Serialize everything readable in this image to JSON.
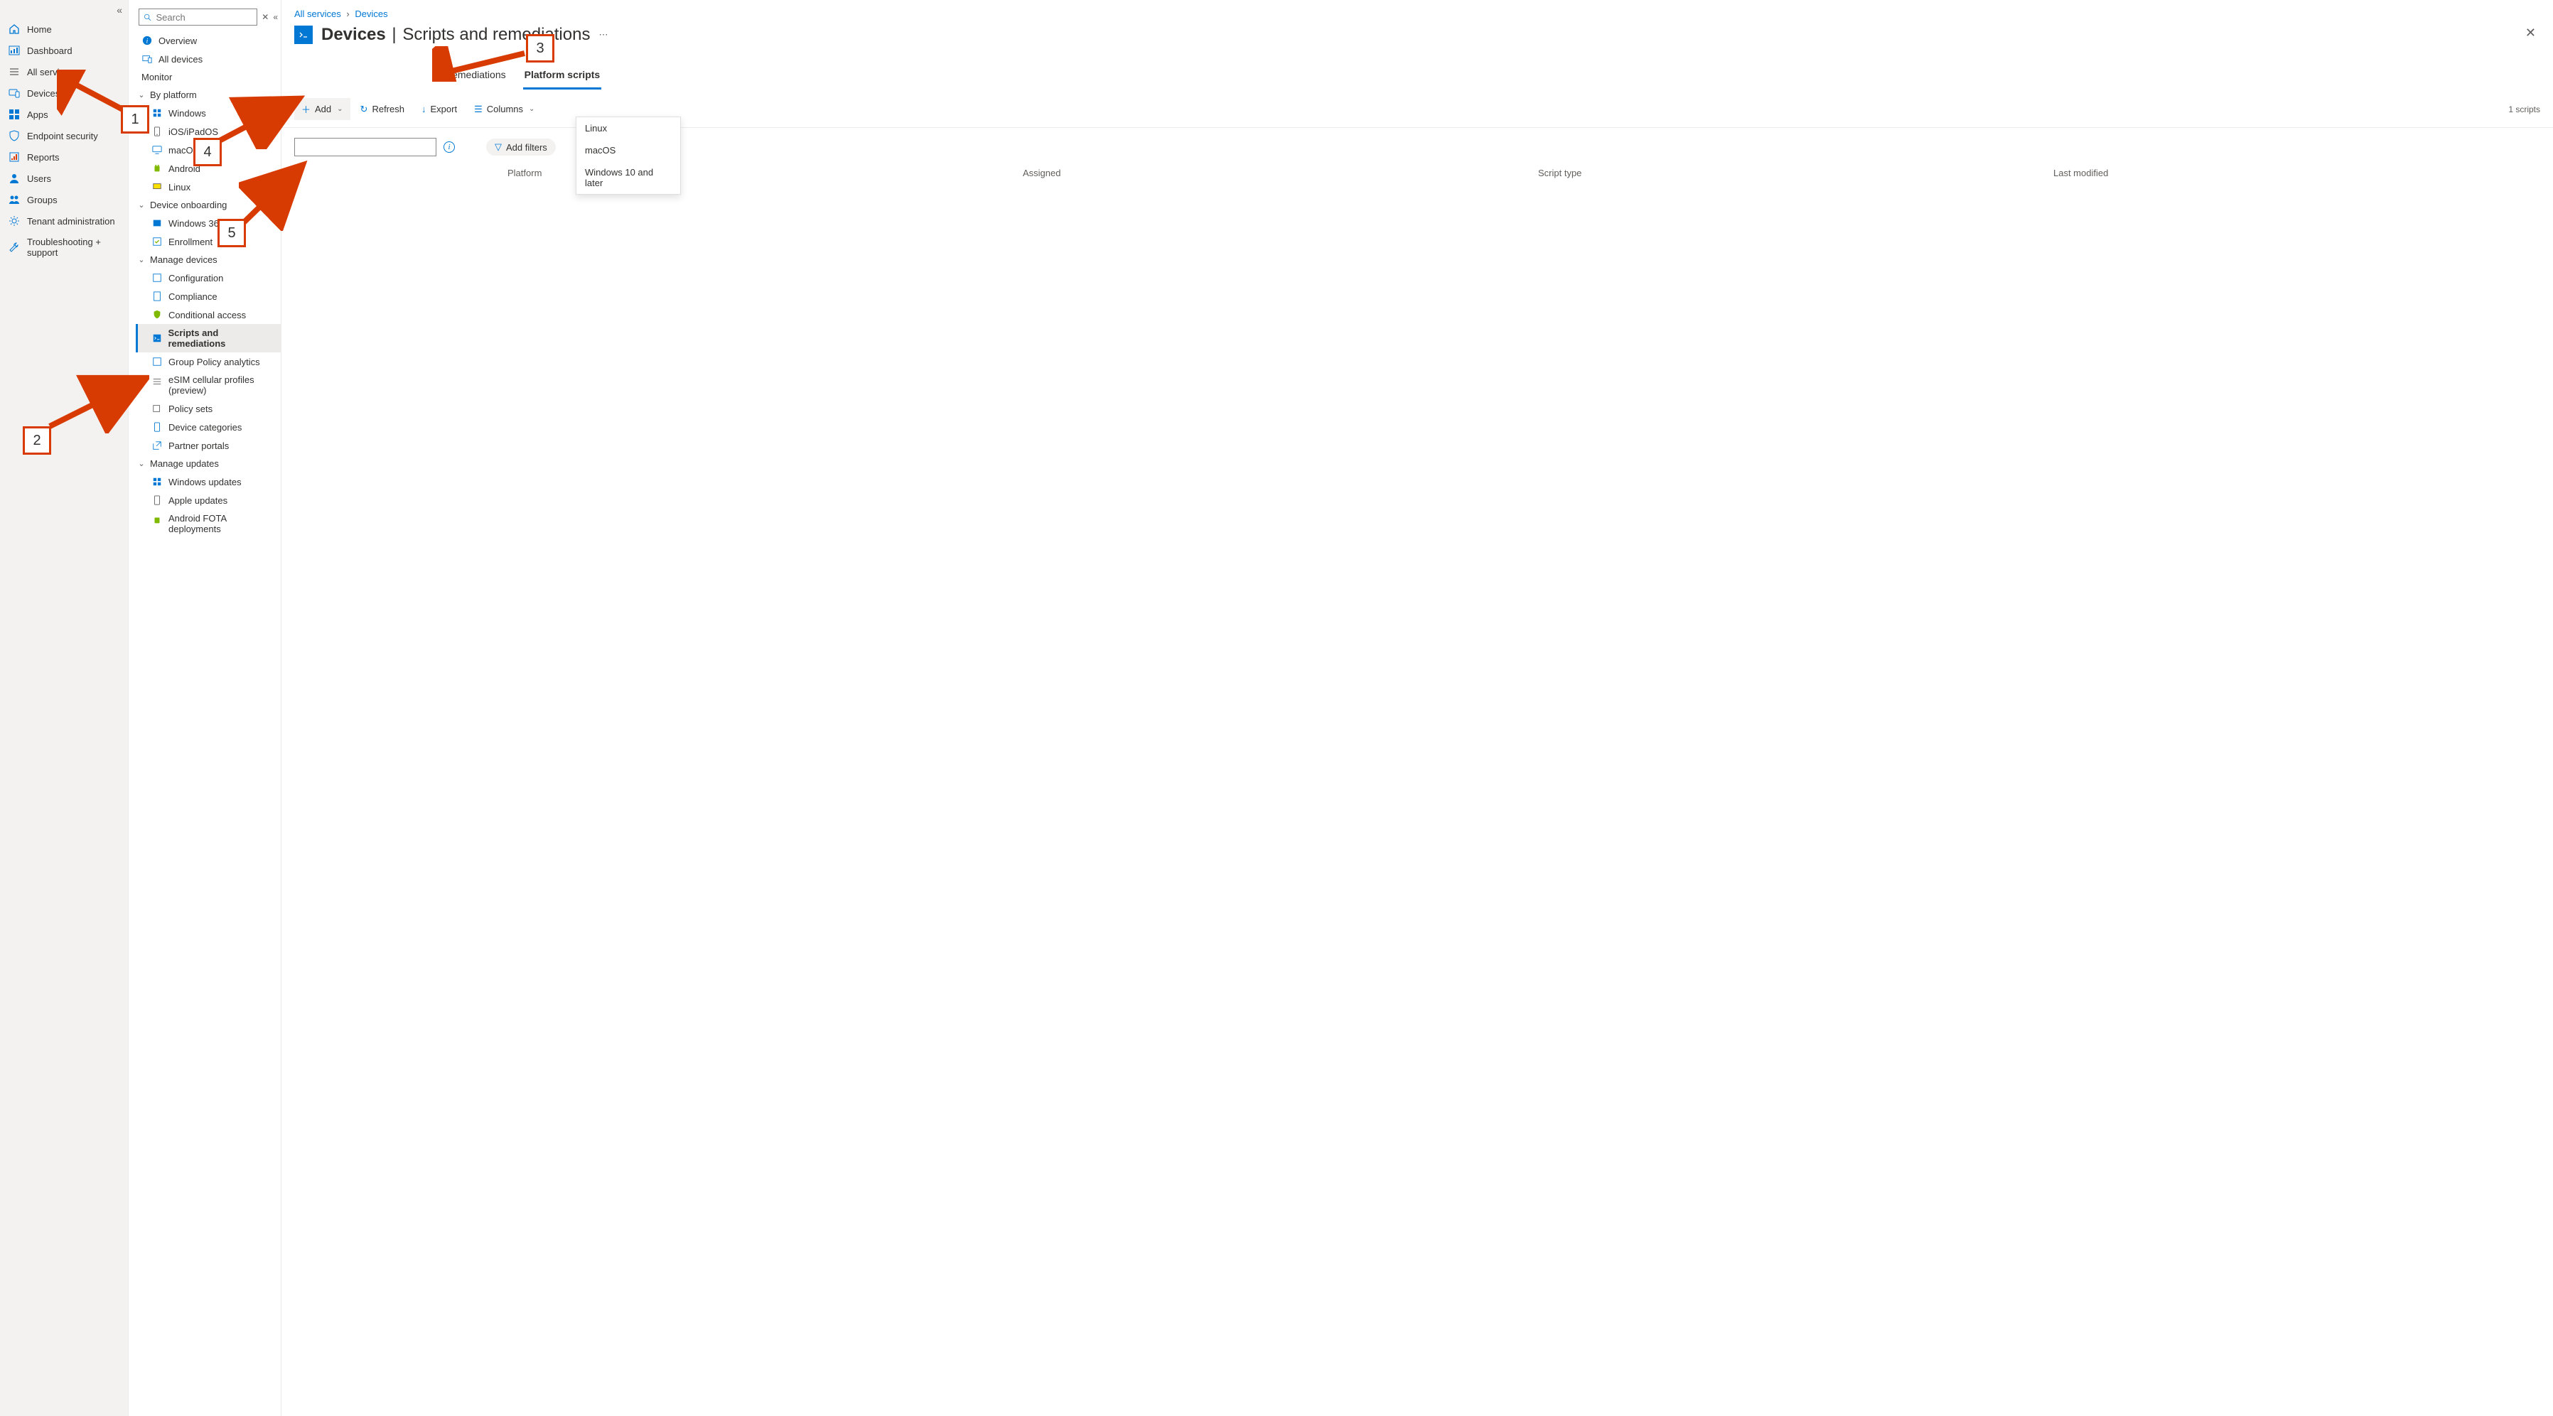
{
  "global_nav": {
    "items": [
      {
        "label": "Home"
      },
      {
        "label": "Dashboard"
      },
      {
        "label": "All services"
      },
      {
        "label": "Devices"
      },
      {
        "label": "Apps"
      },
      {
        "label": "Endpoint security"
      },
      {
        "label": "Reports"
      },
      {
        "label": "Users"
      },
      {
        "label": "Groups"
      },
      {
        "label": "Tenant administration"
      },
      {
        "label": "Troubleshooting + support"
      }
    ]
  },
  "resource_nav": {
    "search_placeholder": "Search",
    "overview": "Overview",
    "all_devices": "All devices",
    "monitor": "Monitor",
    "groups": {
      "by_platform": {
        "label": "By platform",
        "items": [
          "Windows",
          "iOS/iPadOS",
          "macOS",
          "Android",
          "Linux"
        ]
      },
      "device_onboarding": {
        "label": "Device onboarding",
        "items": [
          "Windows 365",
          "Enrollment"
        ]
      },
      "manage_devices": {
        "label": "Manage devices",
        "items": [
          "Configuration",
          "Compliance",
          "Conditional access",
          "Scripts and remediations",
          "Group Policy analytics",
          "eSIM cellular profiles (preview)",
          "Policy sets",
          "Device categories",
          "Partner portals"
        ]
      },
      "manage_updates": {
        "label": "Manage updates",
        "items": [
          "Windows updates",
          "Apple updates",
          "Android FOTA deployments"
        ]
      }
    }
  },
  "breadcrumb": {
    "root": "All services",
    "current": "Devices"
  },
  "page": {
    "title_bold": "Devices",
    "title_light": "Scripts and remediations"
  },
  "tabs": {
    "remediations": "Remediations",
    "platform_scripts": "Platform scripts"
  },
  "commands": {
    "add": "Add",
    "refresh": "Refresh",
    "export": "Export",
    "columns": "Columns",
    "scripts_count": "1 scripts"
  },
  "add_menu": {
    "linux": "Linux",
    "macos": "macOS",
    "windows": "Windows 10 and later"
  },
  "filters": {
    "add_filters": "Add filters"
  },
  "table": {
    "columns": {
      "platform": "Platform",
      "assigned": "Assigned",
      "script_type": "Script type",
      "last_modified": "Last modified"
    }
  },
  "callouts": {
    "c1": "1",
    "c2": "2",
    "c3": "3",
    "c4": "4",
    "c5": "5"
  }
}
